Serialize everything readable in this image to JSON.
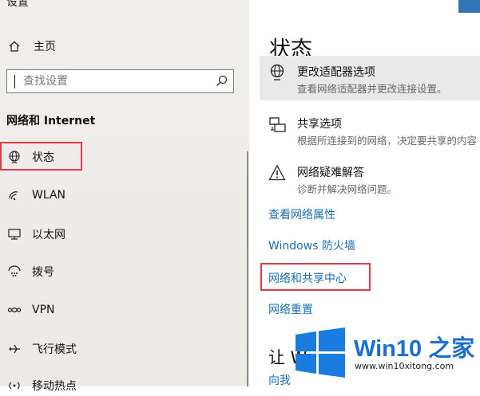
{
  "window": {
    "title": "设置"
  },
  "sidebar": {
    "home_label": "主页",
    "search_placeholder": "查找设置",
    "section_title": "网络和 Internet",
    "items": [
      {
        "label": "状态",
        "icon": "globe-icon"
      },
      {
        "label": "WLAN",
        "icon": "wifi-icon"
      },
      {
        "label": "以太网",
        "icon": "ethernet-icon"
      },
      {
        "label": "拨号",
        "icon": "dialup-icon"
      },
      {
        "label": "VPN",
        "icon": "vpn-icon"
      },
      {
        "label": "飞行模式",
        "icon": "airplane-icon"
      },
      {
        "label": "移动热点",
        "icon": "hotspot-icon"
      }
    ]
  },
  "main": {
    "title": "状态",
    "options": [
      {
        "title": "更改适配器选项",
        "desc": "查看网络适配器并更改连接设置。",
        "icon": "adapter-icon"
      },
      {
        "title": "共享选项",
        "desc": "根据所连接到的网络，决定要共享的内容",
        "icon": "sharing-icon"
      },
      {
        "title": "网络疑难解答",
        "desc": "诊断并解决网络问题。",
        "icon": "warning-icon"
      }
    ],
    "links": [
      "查看网络属性",
      "Windows 防火墙",
      "网络和共享中心",
      "网络重置"
    ],
    "bottom_heading": "让 W",
    "bottom_link": "向我"
  },
  "watermark": {
    "brand": "Win10 之家",
    "url": "www.win10xitong.com"
  },
  "colors": {
    "accent_link": "#1b6eaf",
    "highlight_border": "#e33a46",
    "logo_blue": "#1a6fd0"
  }
}
